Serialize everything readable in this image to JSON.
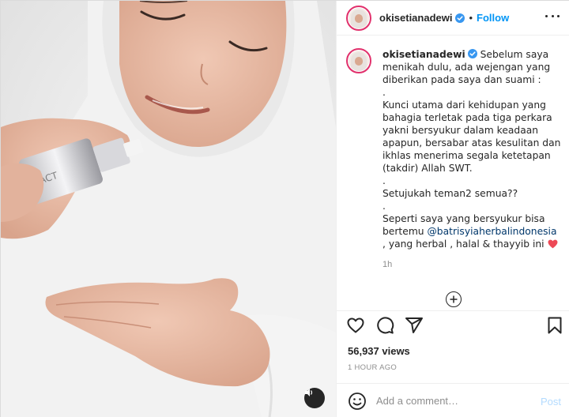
{
  "post": {
    "username": "okisetianadewi",
    "follow_label": "Follow",
    "separator": "•"
  },
  "caption": {
    "username": "okisetianadewi",
    "text": " Sebelum saya menikah dulu, ada wejengan yang diberikan pada saya dan suami :\n.\nKunci utama dari kehidupan yang bahagia terletak pada tiga perkara yakni bersyukur dalam keadaan apapun, bersabar atas kesulitan dan ikhlas menerima segala ketetapan (takdir) Allah SWT.\n.\nSetujukah teman2 semua??\n.\nSeperti saya yang bersyukur bisa bertemu ",
    "mention": "@batrisyiaherbalindonesia",
    "tail": " , yang herbal , halal & thayyib ini ",
    "age": "1h"
  },
  "stats": {
    "views": "56,937 views",
    "time_ago": "1 HOUR AGO"
  },
  "comment": {
    "placeholder": "Add a comment…",
    "post_label": "Post"
  },
  "icons": {
    "verified": "verified-badge-icon",
    "more": "more-options-icon",
    "like": "heart-icon",
    "comment": "comment-icon",
    "share": "share-icon",
    "save": "bookmark-icon",
    "emoji": "emoji-icon",
    "load_more": "plus-circle-icon",
    "sound": "speaker-icon"
  },
  "colors": {
    "accent": "#0095f6",
    "verified": "#3897f0",
    "heart": "#ed4956",
    "mention": "#00376b"
  }
}
